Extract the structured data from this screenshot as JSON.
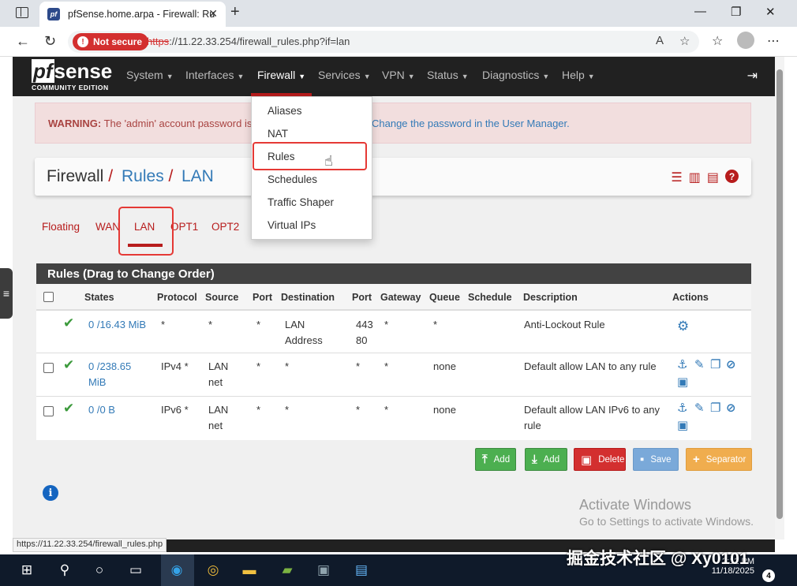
{
  "browser": {
    "tab_title": "pfSense.home.arpa - Firewall: Ru",
    "tab_favicon": "pf",
    "not_secure": "Not secure",
    "url_scheme": "https",
    "url_rest": "://11.22.33.254/firewall_rules.php?if=lan",
    "status_url": "https://11.22.33.254/firewall_rules.php"
  },
  "logo": {
    "pf": "pf",
    "sense": "sense",
    "edition": "COMMUNITY EDITION"
  },
  "nav": [
    {
      "label": "System"
    },
    {
      "label": "Interfaces"
    },
    {
      "label": "Firewall"
    },
    {
      "label": "Services"
    },
    {
      "label": "VPN"
    },
    {
      "label": "Status"
    },
    {
      "label": "Diagnostics"
    },
    {
      "label": "Help"
    }
  ],
  "dropdown": [
    "Aliases",
    "NAT",
    "Rules",
    "Schedules",
    "Traffic Shaper",
    "Virtual IPs"
  ],
  "warning": {
    "prefix": "WARNING:",
    "text": "The 'admin' account password is",
    "tail": "Change the password in the User Manager."
  },
  "breadcrumb": {
    "c1": "Firewall",
    "c2": "Rules",
    "c3": "LAN",
    "sep": "/"
  },
  "iftabs": [
    "Floating",
    "WAN",
    "LAN",
    "OPT1",
    "OPT2"
  ],
  "panel_title": "Rules (Drag to Change Order)",
  "columns": [
    "States",
    "Protocol",
    "Source",
    "Port",
    "Destination",
    "Port",
    "Gateway",
    "Queue",
    "Schedule",
    "Description",
    "Actions"
  ],
  "rows": [
    {
      "states": "0 /16.43 MiB",
      "protocol": "*",
      "source": "*",
      "port": "*",
      "dest1": "LAN",
      "dest2": "Address",
      "dport1": "443",
      "dport2": "80",
      "gateway": "*",
      "queue": "*",
      "schedule": "",
      "desc": "Anti-Lockout Rule"
    },
    {
      "states1": "0 /238.65",
      "states2": "MiB",
      "protocol": "IPv4 *",
      "source1": "LAN",
      "source2": "net",
      "port": "*",
      "dest": "*",
      "dport": "*",
      "gateway": "*",
      "queue": "none",
      "schedule": "",
      "desc": "Default allow LAN to any rule"
    },
    {
      "states": "0 /0 B",
      "protocol": "IPv6 *",
      "source1": "LAN",
      "source2": "net",
      "port": "*",
      "dest": "*",
      "dport": "*",
      "gateway": "*",
      "queue": "none",
      "schedule": "",
      "desc1": "Default allow LAN IPv6 to any",
      "desc2": "rule"
    }
  ],
  "buttons": {
    "add_top": "Add",
    "add_bottom": "Add",
    "delete": "Delete",
    "save": "Save",
    "separator": "Separator"
  },
  "activate": {
    "line1": "Activate Windows",
    "line2": "Go to Settings to activate Windows."
  },
  "clock": {
    "time": "2:12 PM",
    "date": "11/18/2025"
  },
  "watermark": "掘金技术社区 @ Xy0101",
  "notifications": "4",
  "colors": {
    "brand_red": "#b71c1c",
    "link_blue": "#337ab7",
    "success_green": "#4caf50"
  }
}
